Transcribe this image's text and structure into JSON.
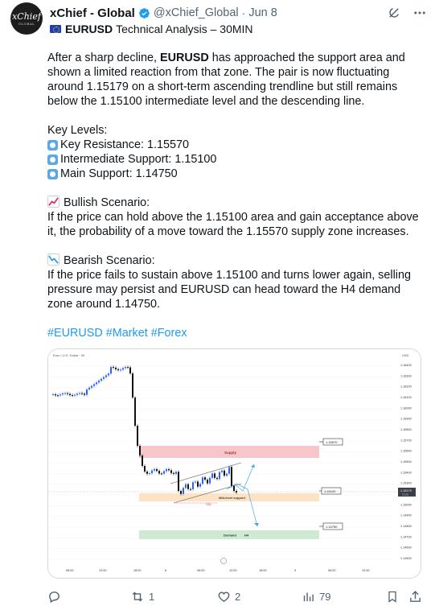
{
  "author": {
    "name": "xChief - Global",
    "handle": "@xChief_Global",
    "date": "Jun 8",
    "avatar_text": "xChief",
    "avatar_sub": "GLOBAL"
  },
  "subtitle": {
    "pair": "EURUSD",
    "rest": "Technical Analysis – 30MIN"
  },
  "body": {
    "intro_prefix": "After a sharp decline, ",
    "intro_bold": "EURUSD",
    "intro_suffix": " has approached the support area and shown a limited reaction from that zone. The pair is now fluctuating around 1.15179 on a short-term ascending trendline but still remains below the 1.15100 intermediate level and the descending line.",
    "key_levels_title": "Key Levels:",
    "key_levels": [
      "Key Resistance: 1.15570",
      "Intermediate Support: 1.15100",
      "Main Support: 1.14750"
    ],
    "bullish_title": "Bullish Scenario:",
    "bullish_text": "If the price can hold above the 1.15100 area and gain acceptance above it, the probability of a move toward the 1.15570 supply zone increases.",
    "bearish_title": "Bearish Scenario:",
    "bearish_text": "If the price fails to sustain above 1.15100 and turns lower again, selling pressure may persist and EURUSD can head toward the H4 demand zone around 1.14750.",
    "hashtags": "#EURUSD #Market #Forex"
  },
  "chart": {
    "symbol": "Euro / U.S. Dollar · 30",
    "currency": "USD",
    "price_labels": [
      "1.16400",
      "1.16300",
      "1.16200",
      "1.16100",
      "1.16000",
      "1.15900",
      "1.15800",
      "1.15700",
      "1.15600",
      "1.15500",
      "1.15400",
      "1.15300",
      "1.15200",
      "1.15000",
      "1.14900",
      "1.14800",
      "1.14700",
      "1.14600",
      "1.14500"
    ],
    "current_price": "1.15179",
    "current_time": "10:28",
    "time_labels": [
      "06:00",
      "12:00",
      "18:00",
      "6",
      "06:00",
      "12:00",
      "18:00",
      "9",
      "06:00",
      "12:00"
    ],
    "zones": {
      "supply_label": "Supply",
      "supply_value": "1.15570",
      "mid_label": "Mid-level support",
      "mid_value": "1.15100",
      "demand_label": "Demand",
      "demand_tf": "H4",
      "demand_value": "1.14750",
      "ssl_label": "SSL"
    },
    "colors": {
      "supply": "#f7c6cb",
      "mid": "#fde3c3",
      "demand": "#cfead3",
      "candle": "#2962ff",
      "projection": "#4aa3df"
    }
  },
  "actions": {
    "reply_count": "",
    "retweet_count": "1",
    "like_count": "2",
    "views_count": "79"
  }
}
